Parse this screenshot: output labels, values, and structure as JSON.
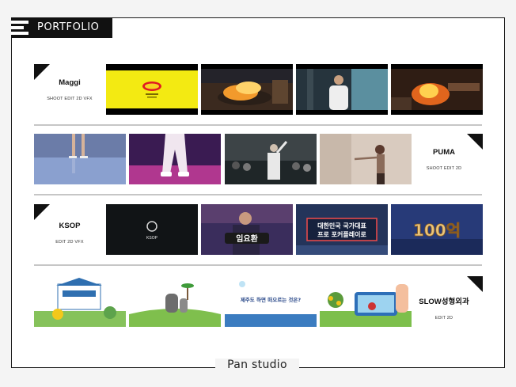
{
  "header": {
    "title": "PORTFOLIO",
    "menu_icon": "menu-lines-icon"
  },
  "footer": {
    "brand": "Pan studio"
  },
  "projects": [
    {
      "name": "Maggi",
      "tags": "SHOOT EDIT 2D VFX",
      "thumbs": [
        "maggi-logo-frame",
        "wok-flame-frame",
        "chef-portrait-frame",
        "cooking-fire-frame"
      ]
    },
    {
      "name": "PUMA",
      "tags": "SHOOT EDIT 2D",
      "thumbs": [
        "legs-water-frame",
        "pink-pants-frame",
        "crowd-performer-frame",
        "dancer-frame"
      ]
    },
    {
      "name": "KSOP",
      "tags": "EDIT 2D VFX",
      "thumbs": [
        "ksop-logo-frame",
        "host-frame",
        "broadcast-title-frame",
        "100-billion-frame"
      ],
      "thumb_text": [
        "KSOP",
        "임요환",
        "대한민국 국가대표\n프로 포커플레이로",
        "100억"
      ]
    },
    {
      "name": "SLOW성형외과",
      "tags": "EDIT 2D",
      "thumbs": [
        "clinic-building-frame",
        "stone-statue-frame",
        "jeju-question-frame",
        "phone-camera-frame"
      ],
      "thumb_text": [
        "",
        "",
        "제주도 하면 떠오르는 것은?",
        ""
      ]
    }
  ]
}
